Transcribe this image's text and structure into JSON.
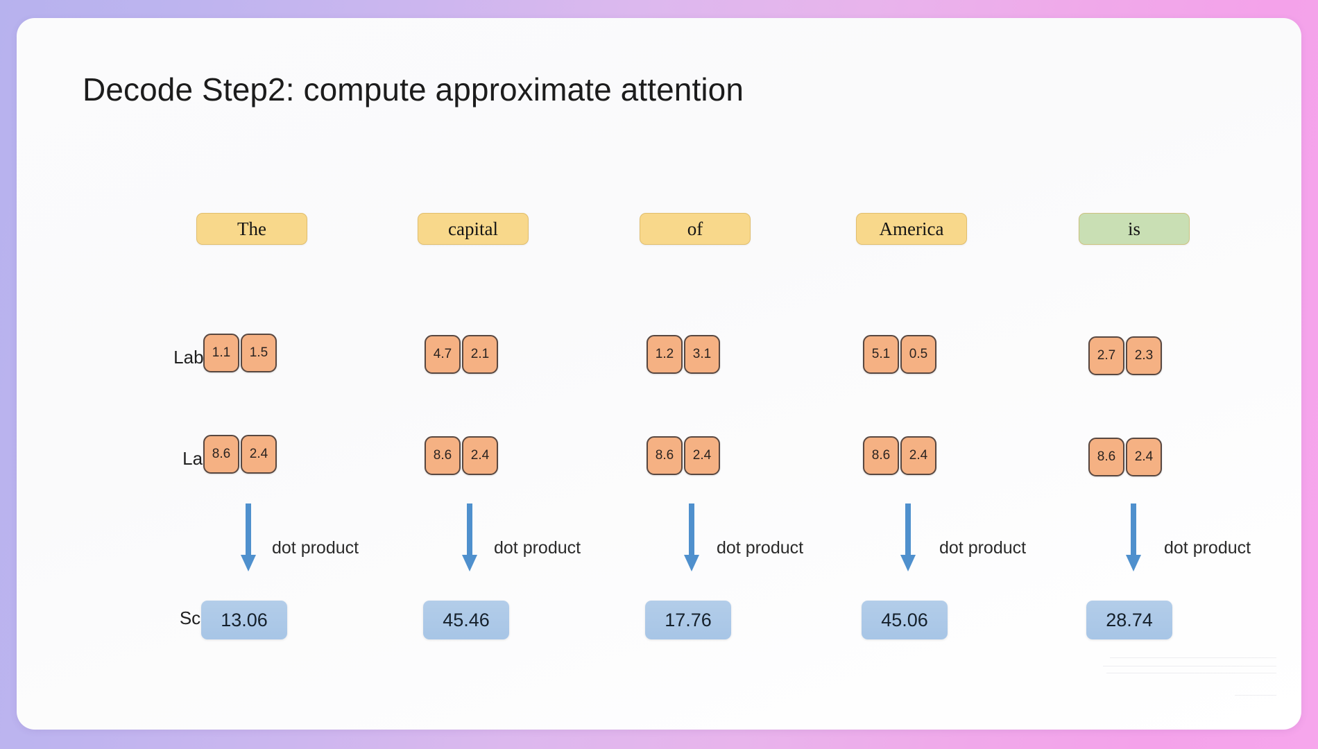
{
  "slide": {
    "title": "Decode Step2: compute approximate attention",
    "background_gradient_from": "#b7b2ee",
    "background_gradient_to": "#f4a2ea",
    "card_background": "#fbfbfc"
  },
  "rows": {
    "labels_row_label": "Labels:",
    "label_row_label": "Label:",
    "score_row_label": "Score:",
    "operation_label": "dot product"
  },
  "colors": {
    "token_amber": "#f8d88b",
    "token_green": "#c9dfb4",
    "cell_fill": "#f5b183",
    "cell_border": "#584740",
    "score_fill": "#b3cde9",
    "arrow": "#4f90cd"
  },
  "columns": [
    {
      "token": "The",
      "token_color": "amber",
      "labels": [
        "1.1",
        "1.5"
      ],
      "query": [
        "8.6",
        "2.4"
      ],
      "op": "dot product",
      "score": "13.06"
    },
    {
      "token": "capital",
      "token_color": "amber",
      "labels": [
        "4.7",
        "2.1"
      ],
      "query": [
        "8.6",
        "2.4"
      ],
      "op": "dot product",
      "score": "45.46"
    },
    {
      "token": "of",
      "token_color": "amber",
      "labels": [
        "1.2",
        "3.1"
      ],
      "query": [
        "8.6",
        "2.4"
      ],
      "op": "dot product",
      "score": "17.76"
    },
    {
      "token": "America",
      "token_color": "amber",
      "labels": [
        "5.1",
        "0.5"
      ],
      "query": [
        "8.6",
        "2.4"
      ],
      "op": "dot product",
      "score": "45.06"
    },
    {
      "token": "is",
      "token_color": "green",
      "labels": [
        "2.7",
        "2.3"
      ],
      "query": [
        "8.6",
        "2.4"
      ],
      "op": "dot product",
      "score": "28.74"
    }
  ]
}
